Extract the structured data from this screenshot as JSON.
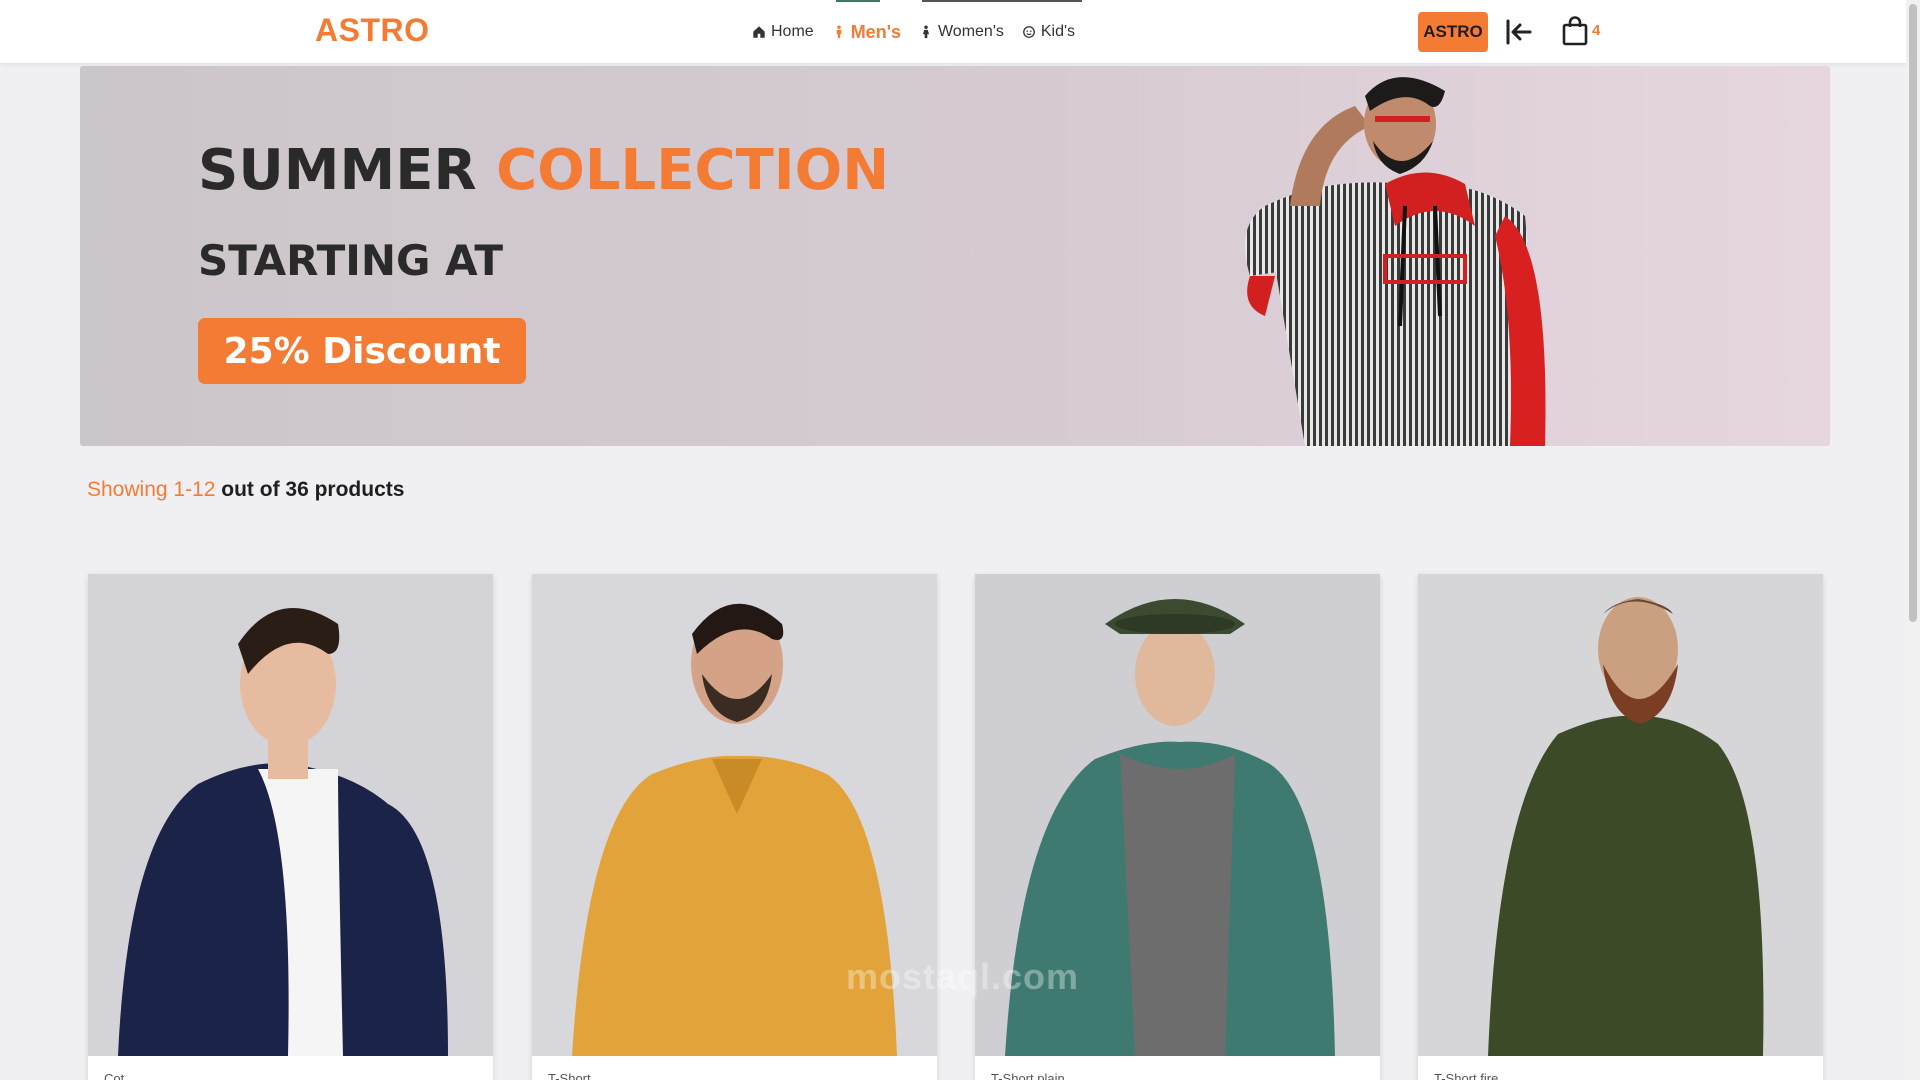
{
  "brand": "ASTRO",
  "nav": {
    "links": [
      {
        "label": "Home",
        "icon": "home-icon"
      },
      {
        "label": "Men's",
        "icon": "man-icon",
        "active": true
      },
      {
        "label": "Women's",
        "icon": "woman-icon"
      },
      {
        "label": "Kid's",
        "icon": "child-icon"
      }
    ],
    "user_button": "ASTRO",
    "cart_count": "4"
  },
  "hero": {
    "title_part1": "SUMMER",
    "title_part2": "COLLECTION",
    "subtitle": "STARTING AT",
    "cta": "25% Discount"
  },
  "results": {
    "range": "Showing 1-12",
    "total": "out of 36 products"
  },
  "products": [
    {
      "name": "Cot...",
      "image": "man in navy zip jacket"
    },
    {
      "name": "T-Short",
      "image": "man in yellow polo shirt"
    },
    {
      "name": "T-Short plain",
      "image": "man in denim jacket and hat"
    },
    {
      "name": "T-Short fire",
      "image": "bearded man in olive t-shirt"
    }
  ],
  "watermark": "mostaql.com",
  "colors": {
    "accent": "#f47b34",
    "background": "#f0f0f3",
    "nav_bg": "#ffffff"
  }
}
